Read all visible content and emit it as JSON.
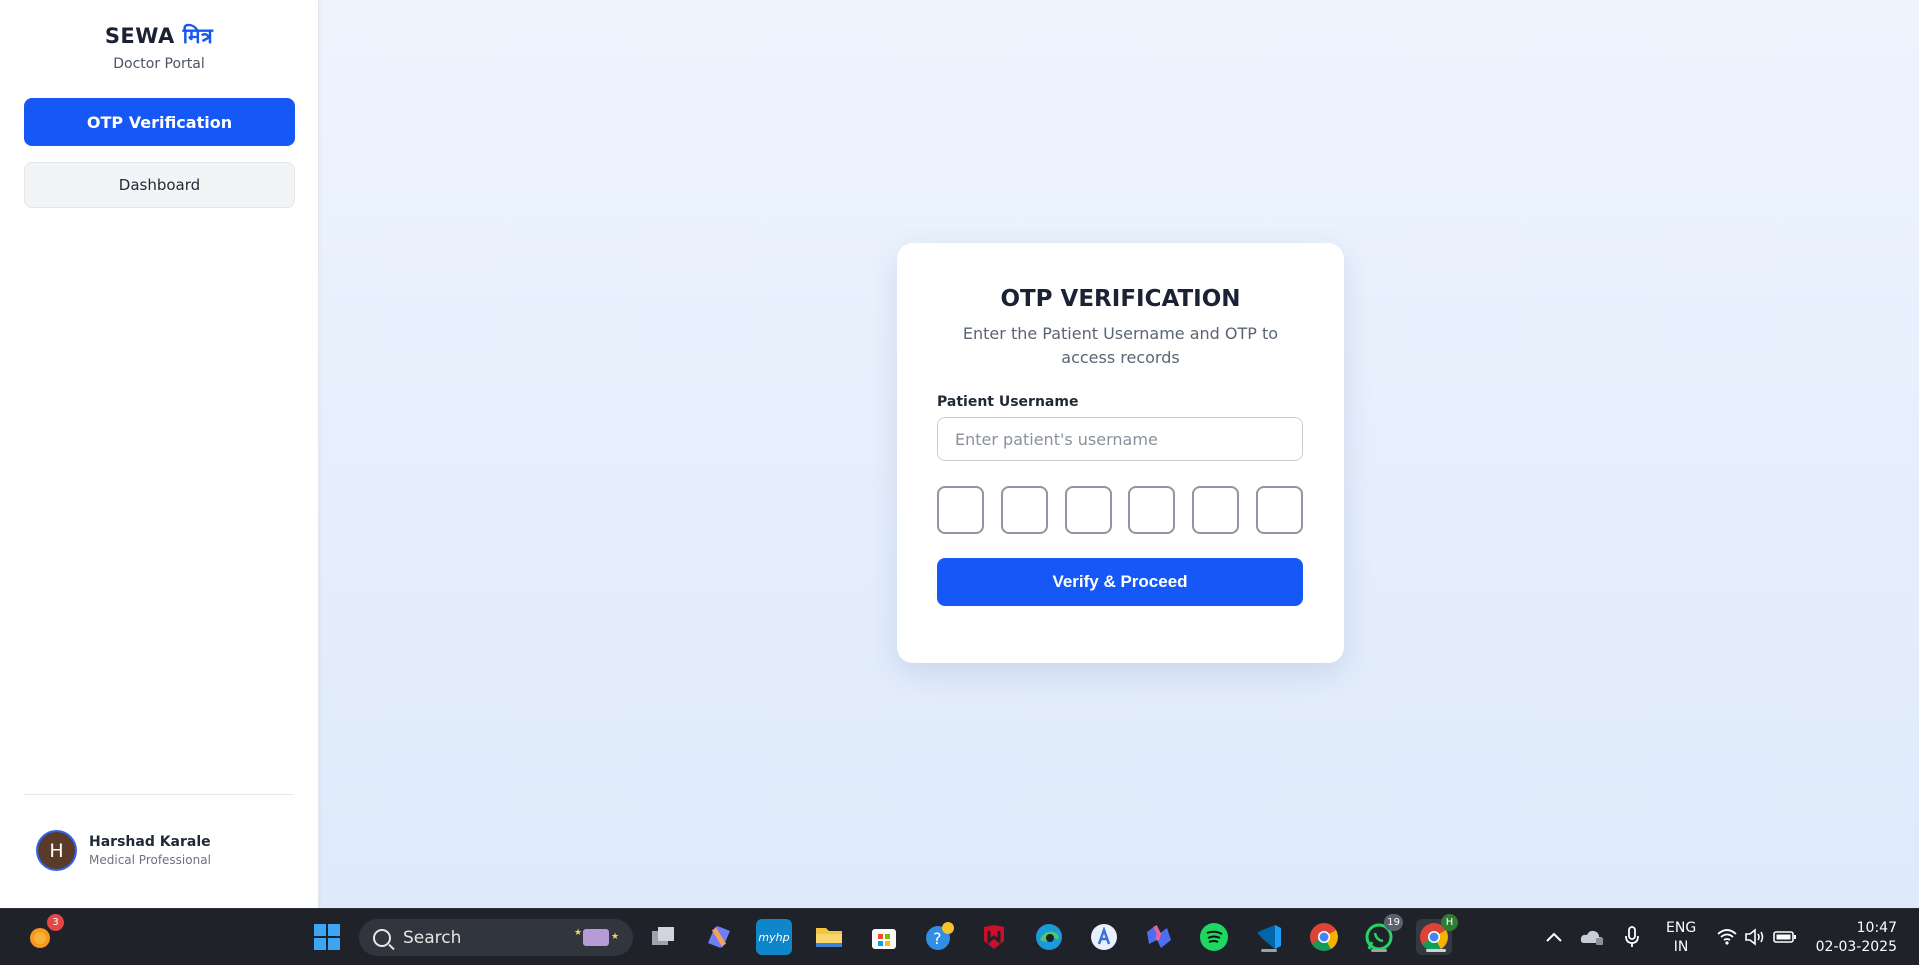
{
  "sidebar": {
    "brand_name": "SEWA",
    "brand_accent": "मित्र",
    "brand_subtitle": "Doctor Portal",
    "nav": [
      {
        "label": "OTP Verification",
        "active": true
      },
      {
        "label": "Dashboard",
        "active": false
      }
    ],
    "user": {
      "initial": "H",
      "name": "Harshad Karale",
      "role": "Medical Professional"
    }
  },
  "card": {
    "title": "OTP VERIFICATION",
    "subtitle": "Enter the Patient Username and OTP to access records",
    "username_label": "Patient Username",
    "username_placeholder": "Enter patient's username",
    "username_value": "",
    "otp_digits": [
      "",
      "",
      "",
      "",
      "",
      ""
    ],
    "submit_label": "Verify & Proceed"
  },
  "colors": {
    "primary": "#1658f6",
    "brand_accent": "#1658f0",
    "background": "#e4eefc"
  },
  "taskbar": {
    "search_placeholder": "Search",
    "weather_badge": "3",
    "whatsapp_badge": "19",
    "chrome_profile_badge": "H",
    "icons": [
      "weather-icon",
      "windows-start-icon",
      "search-icon",
      "task-view-icon",
      "copilot-icon",
      "myhp-icon",
      "file-explorer-icon",
      "microsoft-store-icon",
      "get-help-icon",
      "mcafee-icon",
      "edge-icon",
      "app-icon",
      "copilot-app-icon",
      "spotify-icon",
      "vscode-icon",
      "chrome-icon",
      "whatsapp-icon",
      "chrome-profile-icon"
    ],
    "language": "ENG",
    "region": "IN",
    "time": "10:47",
    "date": "02-03-2025"
  }
}
